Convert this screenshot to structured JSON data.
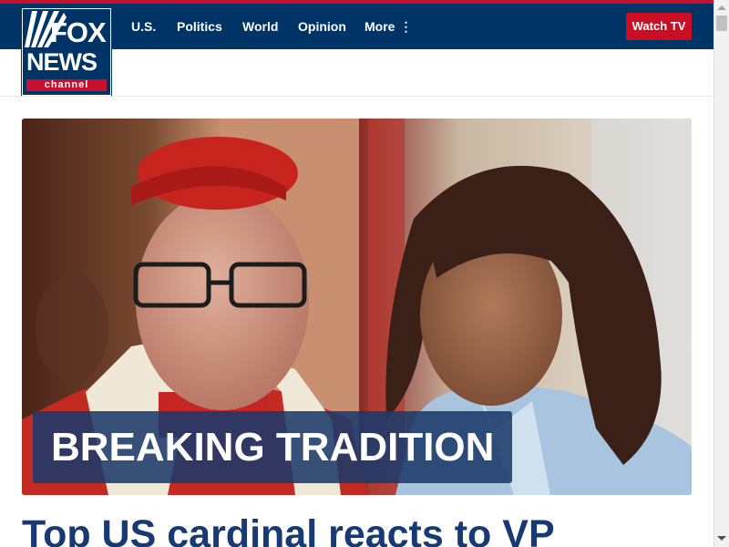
{
  "brand": {
    "logo_fox": "FOX",
    "logo_news": "NEWS",
    "logo_channel": "channel",
    "accent_red": "#c8102e",
    "navy": "#003366"
  },
  "nav": {
    "items": [
      {
        "label": "U.S."
      },
      {
        "label": "Politics"
      },
      {
        "label": "World"
      },
      {
        "label": "Opinion"
      }
    ],
    "more_label": "More",
    "more_icon": "⋮",
    "watch_tv_label": "Watch TV"
  },
  "hero": {
    "kicker": "BREAKING TRADITION",
    "image_subject": "cardinal-and-vice-president-photo"
  },
  "article": {
    "headline": "Top US cardinal reacts to VP"
  }
}
